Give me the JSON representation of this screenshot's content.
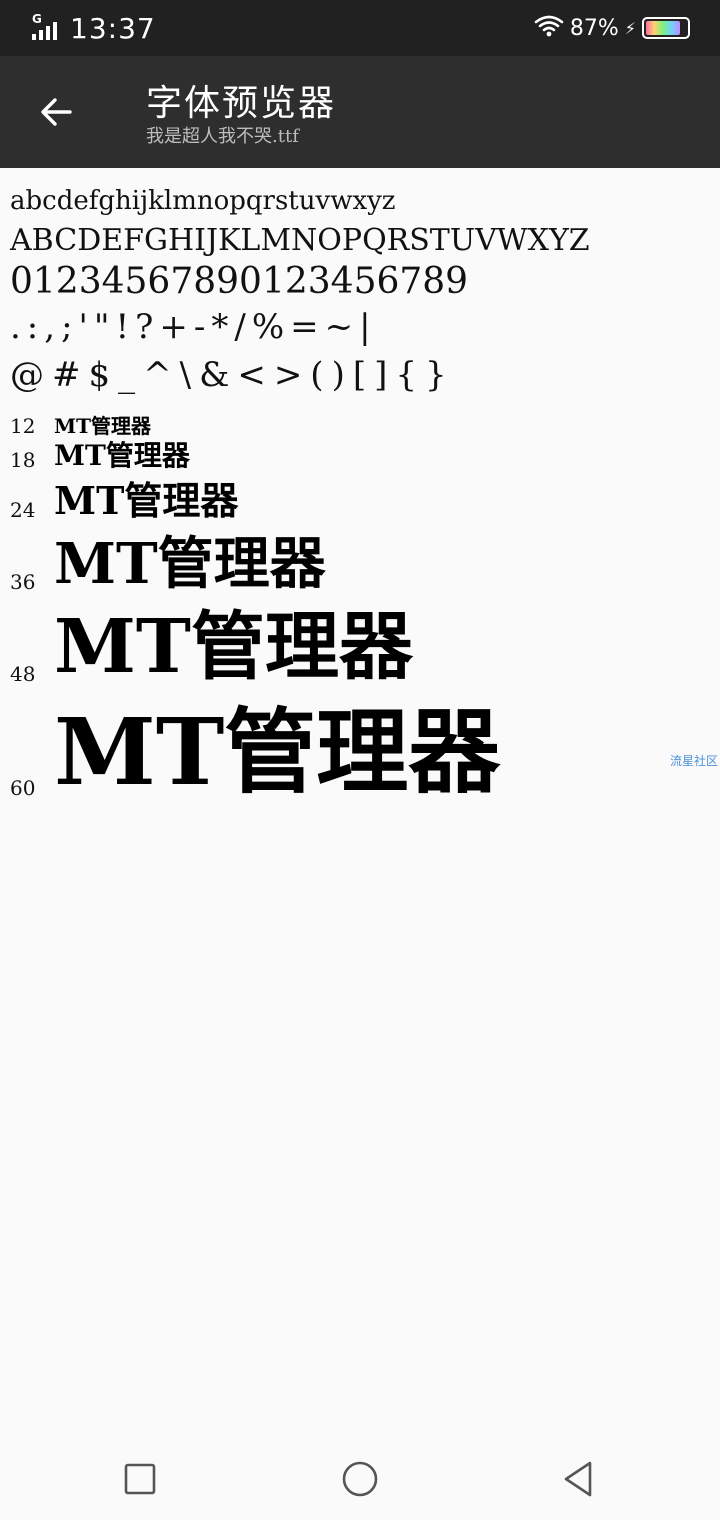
{
  "status_bar": {
    "network_label": "G",
    "time": "13:37",
    "battery_percent": "87%",
    "battery_level": 0.87,
    "icons": [
      "signal-icon",
      "wifi-icon",
      "charging-icon",
      "battery-icon"
    ]
  },
  "toolbar": {
    "back_icon": "arrow-left-icon",
    "title": "字体预览器",
    "subtitle": "我是超人我不哭.ttf"
  },
  "preview": {
    "lowercase": "abcdefghijklmnopqrstuvwxyz",
    "uppercase": "ABCDEFGHIJKLMNOPQRSTUVWXYZ",
    "digits": "01234567890123456789",
    "punctuation_1": ".:,;'\"!?+-*/%=~|",
    "punctuation_2": "@#$_^\\&<>()[]{}",
    "sample_text": "MT管理器",
    "sizes": [
      "12",
      "18",
      "24",
      "36",
      "48",
      "60"
    ]
  },
  "watermark": "流星社区",
  "nav_bar": {
    "icons": [
      "recent-apps-icon",
      "home-icon",
      "back-triangle-icon"
    ]
  },
  "colors": {
    "status_bar_bg": "#212121",
    "toolbar_bg": "#2e2e2e",
    "page_bg": "#fafafa",
    "watermark": "#4a90d9"
  }
}
